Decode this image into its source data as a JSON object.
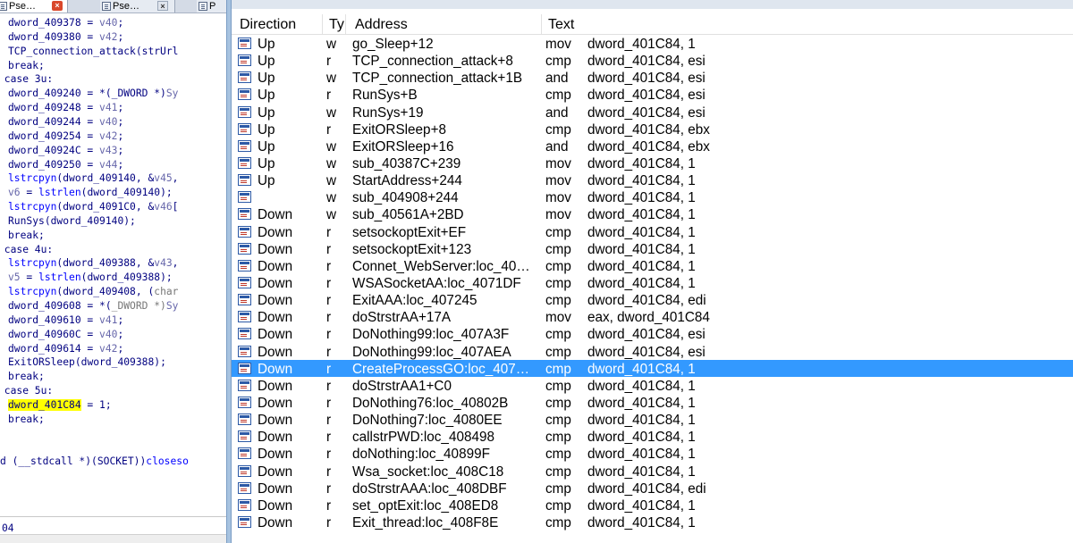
{
  "left_pane": {
    "tabs": [
      {
        "label": "Pse…",
        "close": "×"
      },
      {
        "label": "Pse…",
        "close": "×"
      },
      {
        "label": "P"
      }
    ],
    "status": "04"
  },
  "xrefs": {
    "columns": [
      "Direction",
      "Ty|",
      "Address",
      "Text"
    ],
    "selected_index": 19,
    "rows": [
      {
        "direction": "Up",
        "type": "w",
        "address": "go_Sleep+12",
        "instr": "mov",
        "operands": "dword_401C84, 1"
      },
      {
        "direction": "Up",
        "type": "r",
        "address": "TCP_connection_attack+8",
        "instr": "cmp",
        "operands": "dword_401C84, esi"
      },
      {
        "direction": "Up",
        "type": "w",
        "address": "TCP_connection_attack+1B",
        "instr": "and",
        "operands": "dword_401C84, esi"
      },
      {
        "direction": "Up",
        "type": "r",
        "address": "RunSys+B",
        "instr": "cmp",
        "operands": "dword_401C84, esi"
      },
      {
        "direction": "Up",
        "type": "w",
        "address": "RunSys+19",
        "instr": "and",
        "operands": "dword_401C84, esi"
      },
      {
        "direction": "Up",
        "type": "r",
        "address": "ExitORSleep+8",
        "instr": "cmp",
        "operands": "dword_401C84, ebx"
      },
      {
        "direction": "Up",
        "type": "w",
        "address": "ExitORSleep+16",
        "instr": "and",
        "operands": "dword_401C84, ebx"
      },
      {
        "direction": "Up",
        "type": "w",
        "address": "sub_40387C+239",
        "instr": "mov",
        "operands": "dword_401C84, 1"
      },
      {
        "direction": "Up",
        "type": "w",
        "address": "StartAddress+244",
        "instr": "mov",
        "operands": "dword_401C84, 1"
      },
      {
        "direction": "",
        "type": "w",
        "address": "sub_404908+244",
        "instr": "mov",
        "operands": "dword_401C84, 1"
      },
      {
        "direction": "Down",
        "type": "w",
        "address": "sub_40561A+2BD",
        "instr": "mov",
        "operands": "dword_401C84, 1"
      },
      {
        "direction": "Down",
        "type": "r",
        "address": "setsockoptExit+EF",
        "instr": "cmp",
        "operands": "dword_401C84, 1"
      },
      {
        "direction": "Down",
        "type": "r",
        "address": "setsockoptExit+123",
        "instr": "cmp",
        "operands": "dword_401C84, 1"
      },
      {
        "direction": "Down",
        "type": "r",
        "address": "Connet_WebServer:loc_40…",
        "instr": "cmp",
        "operands": "dword_401C84, 1"
      },
      {
        "direction": "Down",
        "type": "r",
        "address": "WSASocketAA:loc_4071DF",
        "instr": "cmp",
        "operands": "dword_401C84, 1"
      },
      {
        "direction": "Down",
        "type": "r",
        "address": "ExitAAA:loc_407245",
        "instr": "cmp",
        "operands": "dword_401C84, edi"
      },
      {
        "direction": "Down",
        "type": "r",
        "address": "doStrstrAA+17A",
        "instr": "mov",
        "operands": "eax, dword_401C84"
      },
      {
        "direction": "Down",
        "type": "r",
        "address": "DoNothing99:loc_407A3F",
        "instr": "cmp",
        "operands": "dword_401C84, esi"
      },
      {
        "direction": "Down",
        "type": "r",
        "address": "DoNothing99:loc_407AEA",
        "instr": "cmp",
        "operands": "dword_401C84, esi"
      },
      {
        "direction": "Down",
        "type": "r",
        "address": "CreateProcessGO:loc_407…",
        "instr": "cmp",
        "operands": "dword_401C84, 1"
      },
      {
        "direction": "Down",
        "type": "r",
        "address": "doStrstrAA1+C0",
        "instr": "cmp",
        "operands": "dword_401C84, 1"
      },
      {
        "direction": "Down",
        "type": "r",
        "address": "DoNothing76:loc_40802B",
        "instr": "cmp",
        "operands": "dword_401C84, 1"
      },
      {
        "direction": "Down",
        "type": "r",
        "address": "DoNothing7:loc_4080EE",
        "instr": "cmp",
        "operands": "dword_401C84, 1"
      },
      {
        "direction": "Down",
        "type": "r",
        "address": "callstrPWD:loc_408498",
        "instr": "cmp",
        "operands": "dword_401C84, 1"
      },
      {
        "direction": "Down",
        "type": "r",
        "address": "doNothing:loc_40899F",
        "instr": "cmp",
        "operands": "dword_401C84, 1"
      },
      {
        "direction": "Down",
        "type": "r",
        "address": "Wsa_socket:loc_408C18",
        "instr": "cmp",
        "operands": "dword_401C84, 1"
      },
      {
        "direction": "Down",
        "type": "r",
        "address": "doStrstrAAA:loc_408DBF",
        "instr": "cmp",
        "operands": "dword_401C84, edi"
      },
      {
        "direction": "Down",
        "type": "r",
        "address": "set_optExit:loc_408ED8",
        "instr": "cmp",
        "operands": "dword_401C84, 1"
      },
      {
        "direction": "Down",
        "type": "r",
        "address": "Exit_thread:loc_408F8E",
        "instr": "cmp",
        "operands": "dword_401C84, 1"
      }
    ]
  },
  "code_lines": [
    {
      "indent": 4,
      "parts": [
        [
          "d",
          "dword_409378"
        ],
        [
          "k",
          " = "
        ],
        [
          "v",
          "v40"
        ],
        [
          "k",
          ";"
        ]
      ]
    },
    {
      "indent": 4,
      "parts": [
        [
          "d",
          "dword_409380"
        ],
        [
          "k",
          " = "
        ],
        [
          "v",
          "v42"
        ],
        [
          "k",
          ";"
        ]
      ]
    },
    {
      "indent": 4,
      "parts": [
        [
          "d",
          "TCP_connection_attack"
        ],
        [
          "k",
          "("
        ],
        [
          "k",
          "strUrl"
        ]
      ]
    },
    {
      "indent": 4,
      "parts": [
        [
          "k",
          "break;"
        ]
      ]
    },
    {
      "indent": 2,
      "parts": [
        [
          "k",
          "case 3u:"
        ]
      ]
    },
    {
      "indent": 4,
      "parts": [
        [
          "d",
          "dword_409240"
        ],
        [
          "k",
          " = *("
        ],
        [
          "d",
          "_DWORD"
        ],
        [
          "k",
          " *)"
        ],
        [
          "v",
          "Sy"
        ]
      ]
    },
    {
      "indent": 4,
      "parts": [
        [
          "d",
          "dword_409248"
        ],
        [
          "k",
          " = "
        ],
        [
          "v",
          "v41"
        ],
        [
          "k",
          ";"
        ]
      ]
    },
    {
      "indent": 4,
      "parts": [
        [
          "d",
          "dword_409244"
        ],
        [
          "k",
          " = "
        ],
        [
          "v",
          "v40"
        ],
        [
          "k",
          ";"
        ]
      ]
    },
    {
      "indent": 4,
      "parts": [
        [
          "d",
          "dword_409254"
        ],
        [
          "k",
          " = "
        ],
        [
          "v",
          "v42"
        ],
        [
          "k",
          ";"
        ]
      ]
    },
    {
      "indent": 4,
      "parts": [
        [
          "d",
          "dword_40924C"
        ],
        [
          "k",
          " = "
        ],
        [
          "v",
          "v43"
        ],
        [
          "k",
          ";"
        ]
      ]
    },
    {
      "indent": 4,
      "parts": [
        [
          "d",
          "dword_409250"
        ],
        [
          "k",
          " = "
        ],
        [
          "v",
          "v44"
        ],
        [
          "k",
          ";"
        ]
      ]
    },
    {
      "indent": 4,
      "parts": [
        [
          "f",
          "lstrcpyn"
        ],
        [
          "k",
          "("
        ],
        [
          "d",
          "dword_409140"
        ],
        [
          "k",
          ", &"
        ],
        [
          "v",
          "v45"
        ],
        [
          "k",
          ","
        ]
      ]
    },
    {
      "indent": 4,
      "parts": [
        [
          "v",
          "v6"
        ],
        [
          "k",
          " = "
        ],
        [
          "f",
          "lstrlen"
        ],
        [
          "k",
          "("
        ],
        [
          "d",
          "dword_409140"
        ],
        [
          "k",
          ");"
        ]
      ]
    },
    {
      "indent": 4,
      "parts": [
        [
          "f",
          "lstrcpyn"
        ],
        [
          "k",
          "("
        ],
        [
          "d",
          "dword_4091C0"
        ],
        [
          "k",
          ", &"
        ],
        [
          "v",
          "v46"
        ],
        [
          "k",
          "["
        ]
      ]
    },
    {
      "indent": 4,
      "parts": [
        [
          "d",
          "RunSys"
        ],
        [
          "k",
          "("
        ],
        [
          "d",
          "dword_409140"
        ],
        [
          "k",
          ");"
        ]
      ]
    },
    {
      "indent": 4,
      "parts": [
        [
          "k",
          "break;"
        ]
      ]
    },
    {
      "indent": 2,
      "parts": [
        [
          "k",
          "case 4u:"
        ]
      ]
    },
    {
      "indent": 4,
      "parts": [
        [
          "f",
          "lstrcpyn"
        ],
        [
          "k",
          "("
        ],
        [
          "d",
          "dword_409388"
        ],
        [
          "k",
          ", &"
        ],
        [
          "v",
          "v43"
        ],
        [
          "k",
          ","
        ]
      ]
    },
    {
      "indent": 4,
      "parts": [
        [
          "v",
          "v5"
        ],
        [
          "k",
          " = "
        ],
        [
          "f",
          "lstrlen"
        ],
        [
          "k",
          "("
        ],
        [
          "d",
          "dword_409388"
        ],
        [
          "k",
          ");"
        ]
      ]
    },
    {
      "indent": 4,
      "parts": [
        [
          "f",
          "lstrcpyn"
        ],
        [
          "k",
          "("
        ],
        [
          "d",
          "dword_409408"
        ],
        [
          "k",
          ", ("
        ],
        [
          "g",
          "char"
        ]
      ]
    },
    {
      "indent": 4,
      "parts": [
        [
          "d",
          "dword_409608"
        ],
        [
          "k",
          " = *("
        ],
        [
          "g",
          "_DWORD"
        ],
        [
          "g",
          " *)"
        ],
        [
          "v",
          "Sy"
        ]
      ]
    },
    {
      "indent": 4,
      "parts": [
        [
          "d",
          "dword_409610"
        ],
        [
          "k",
          " = "
        ],
        [
          "v",
          "v41"
        ],
        [
          "k",
          ";"
        ]
      ]
    },
    {
      "indent": 4,
      "parts": [
        [
          "d",
          "dword_40960C"
        ],
        [
          "k",
          " = "
        ],
        [
          "v",
          "v40"
        ],
        [
          "k",
          ";"
        ]
      ]
    },
    {
      "indent": 4,
      "parts": [
        [
          "d",
          "dword_409614"
        ],
        [
          "k",
          " = "
        ],
        [
          "v",
          "v42"
        ],
        [
          "k",
          ";"
        ]
      ]
    },
    {
      "indent": 4,
      "parts": [
        [
          "d",
          "ExitORSleep"
        ],
        [
          "k",
          "("
        ],
        [
          "d",
          "dword_409388"
        ],
        [
          "k",
          ");"
        ]
      ]
    },
    {
      "indent": 4,
      "parts": [
        [
          "k",
          "break;"
        ]
      ]
    },
    {
      "indent": 2,
      "parts": [
        [
          "k",
          "case 5u:"
        ]
      ]
    },
    {
      "indent": 4,
      "parts": [
        [
          "hl",
          "dword_401C84"
        ],
        [
          "k",
          " = 1;"
        ]
      ]
    },
    {
      "indent": 4,
      "parts": [
        [
          "k",
          "break;"
        ]
      ]
    },
    {
      "indent": 0,
      "parts": []
    },
    {
      "indent": 0,
      "parts": []
    },
    {
      "indent": 0,
      "parts": [
        [
          "k",
          "d ("
        ],
        [
          "k",
          "__stdcall"
        ],
        [
          "k",
          " *)("
        ],
        [
          "k",
          "SOCKET"
        ],
        [
          "k",
          "))"
        ],
        [
          "f",
          "closeso"
        ]
      ]
    }
  ]
}
